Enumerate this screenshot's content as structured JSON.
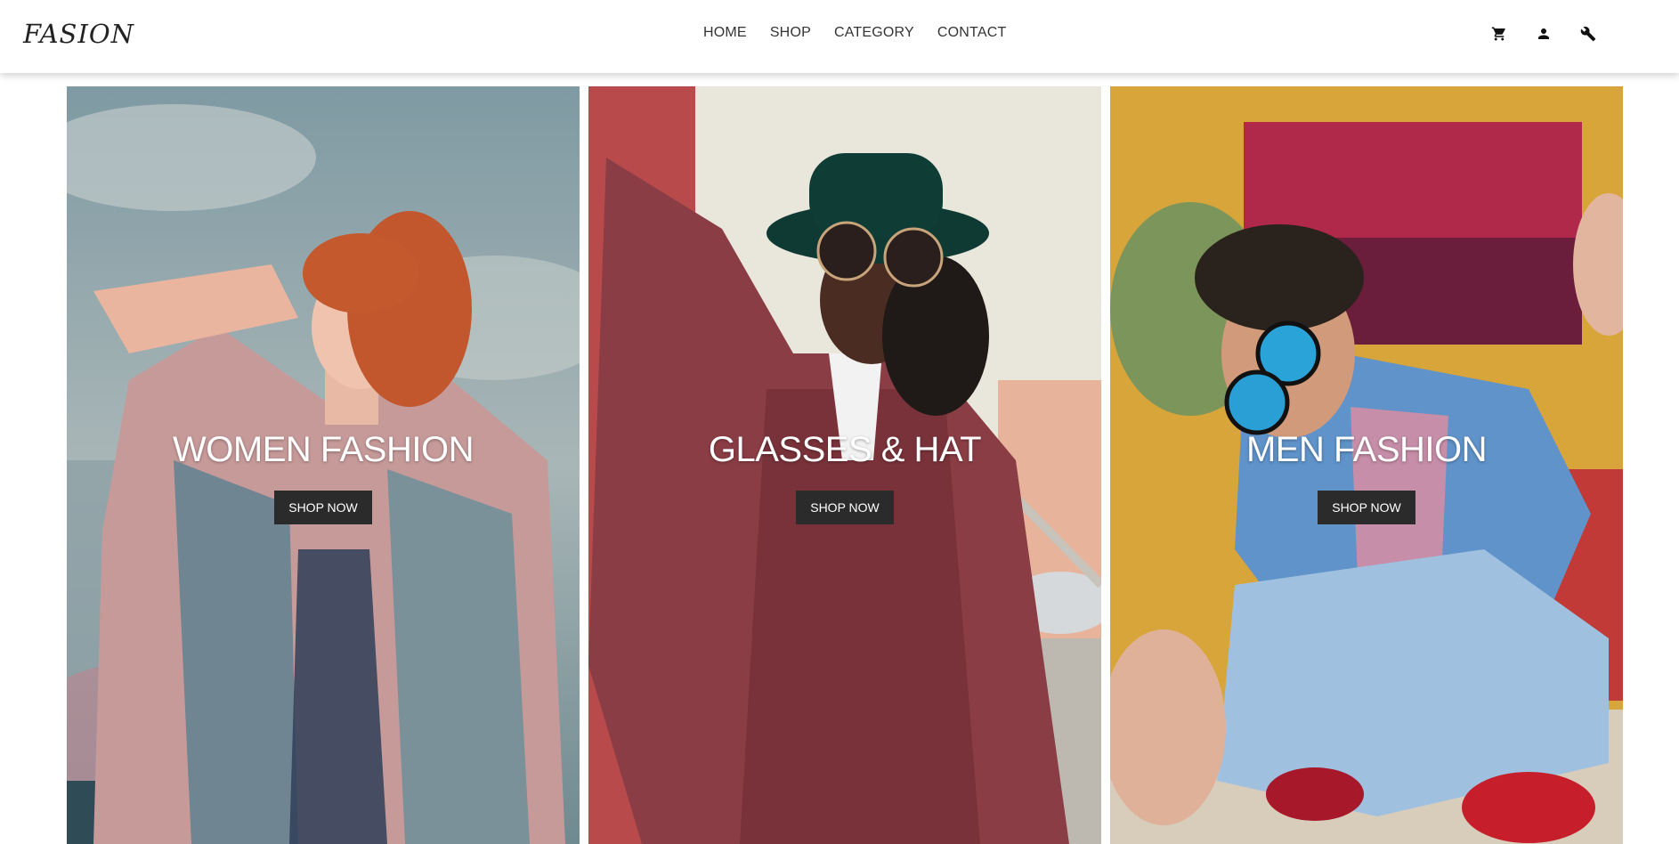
{
  "brand": {
    "logo_text": "FASION"
  },
  "nav": {
    "items": [
      "HOME",
      "SHOP",
      "CATEGORY",
      "CONTACT"
    ]
  },
  "header_icons": [
    "cart-icon",
    "user-icon",
    "wrench-icon"
  ],
  "cards": [
    {
      "title": "WOMEN FASHION",
      "button": "SHOP NOW"
    },
    {
      "title": "GLASSES & HAT",
      "button": "SHOP NOW"
    },
    {
      "title": "MEN FASHION",
      "button": "SHOP NOW"
    }
  ],
  "colors": {
    "button_bg": "#2b2b2b",
    "title_text": "#ffffff",
    "navbar_bg": "#ffffff"
  }
}
